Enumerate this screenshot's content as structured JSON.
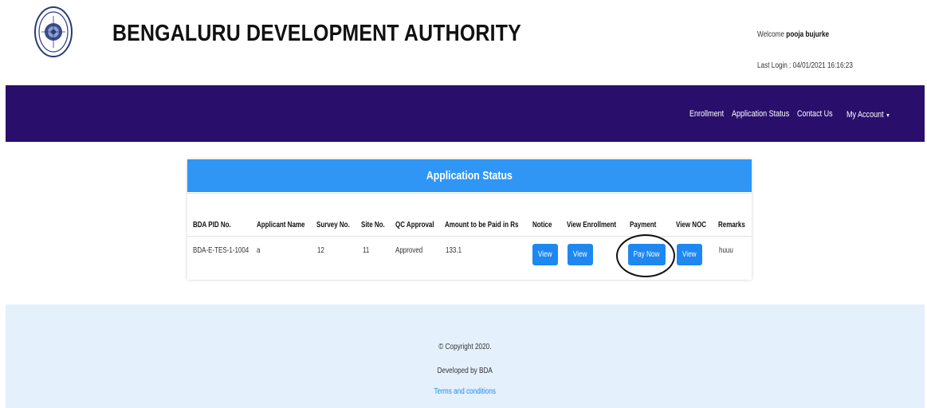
{
  "header": {
    "title": "BENGALURU DEVELOPMENT AUTHORITY",
    "welcome_prefix": "Welcome ",
    "user_name": "pooja bujurke",
    "last_login": "Last Login : 04/01/2021 16:16:23"
  },
  "nav": {
    "items": [
      "Enrollment",
      "Application Status",
      "Contact Us"
    ],
    "account_label": "My Account",
    "account_caret": "▼"
  },
  "card": {
    "title": "Application Status",
    "columns": [
      "BDA PID No.",
      "Applicant Name",
      "Survey No.",
      "Site No.",
      "QC Approval",
      "Amount to be Paid in Rs",
      "Notice",
      "View Enrollment",
      "Payment",
      "View NOC",
      "Remarks"
    ],
    "rows": [
      {
        "pid": "BDA-E-TES-1-1004",
        "applicant": "a",
        "survey": "12",
        "site": "11",
        "qc": "Approved",
        "amount": "133.1",
        "notice_btn": "View",
        "enroll_btn": "View",
        "payment_btn": "Pay Now",
        "noc_btn": "View",
        "remarks": "huuu"
      }
    ]
  },
  "footer": {
    "copyright": "© Copyright 2020.",
    "developed": "Developed by BDA",
    "terms": "Terms and conditions"
  },
  "colors": {
    "navbar": "#2a0e6c",
    "card_header": "#2f96f6",
    "button": "#1e88f0",
    "footer_bg": "#e4f0fb"
  }
}
